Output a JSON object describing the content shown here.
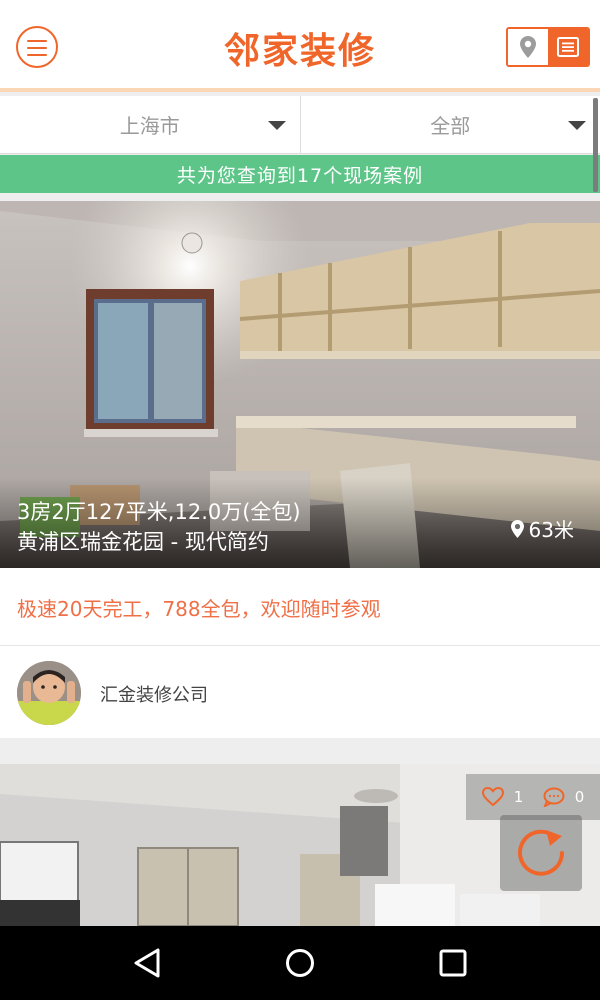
{
  "header": {
    "title": "邻家装修",
    "menu_icon": "menu-icon",
    "location_icon": "map-pin-icon",
    "list_icon": "list-view-icon",
    "accent_color": "#f0662a"
  },
  "filters": {
    "city": "上海市",
    "category": "全部"
  },
  "result_banner": "共为您查询到17个现场案例",
  "cases": [
    {
      "title": "3房2厅127平米,12.0万(全包)",
      "subtitle": "黄浦区瑞金花园 - 现代简约",
      "distance": "63米",
      "promo": "极速20天完工，788全包，欢迎随时参观",
      "company": "汇金装修公司"
    },
    {
      "likes": "1",
      "comments": "0"
    }
  ],
  "colors": {
    "banner_bg": "#5dc588",
    "promo_text": "#ef6f47"
  }
}
